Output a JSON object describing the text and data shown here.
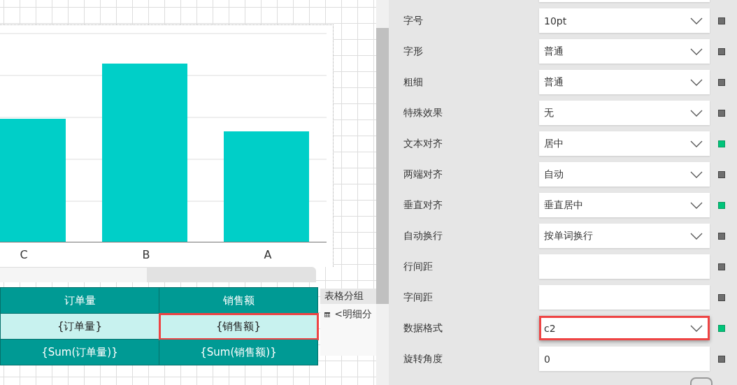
{
  "chart": {
    "categories": [
      "C",
      "B",
      "A"
    ]
  },
  "table": {
    "header": [
      {
        "text": "订单量"
      },
      {
        "text": "销售额"
      }
    ],
    "rows": [
      [
        {
          "text": "{订单量}",
          "selected": false
        },
        {
          "text": "{销售额}",
          "selected": true
        }
      ],
      [
        {
          "text": "{Sum(订单量)}",
          "selected": false
        },
        {
          "text": "{Sum(销售额)}",
          "selected": false
        }
      ]
    ]
  },
  "group_panel": {
    "title": "表格分组",
    "items": [
      "<明细分"
    ]
  },
  "properties": [
    {
      "label": "字号",
      "kind": "select",
      "value": "10pt",
      "modified": false,
      "highlighted": false
    },
    {
      "label": "字形",
      "kind": "select",
      "value": "普通",
      "modified": false,
      "highlighted": false
    },
    {
      "label": "粗细",
      "kind": "select",
      "value": "普通",
      "modified": false,
      "highlighted": false
    },
    {
      "label": "特殊效果",
      "kind": "select",
      "value": "无",
      "modified": false,
      "highlighted": false
    },
    {
      "label": "文本对齐",
      "kind": "select",
      "value": "居中",
      "modified": true,
      "highlighted": false
    },
    {
      "label": "两端对齐",
      "kind": "select",
      "value": "自动",
      "modified": false,
      "highlighted": false
    },
    {
      "label": "垂直对齐",
      "kind": "select",
      "value": "垂直居中",
      "modified": true,
      "highlighted": false
    },
    {
      "label": "自动换行",
      "kind": "select",
      "value": "按单词换行",
      "modified": false,
      "highlighted": false
    },
    {
      "label": "行间距",
      "kind": "text",
      "modified": false,
      "highlighted": false
    },
    {
      "label": "字间距",
      "kind": "text",
      "modified": false,
      "highlighted": false
    },
    {
      "label": "数据格式",
      "kind": "select",
      "value": "c2",
      "modified": true,
      "highlighted": true
    },
    {
      "label": "旋转角度",
      "kind": "text",
      "value": "0",
      "modified": false,
      "highlighted": false
    }
  ]
}
